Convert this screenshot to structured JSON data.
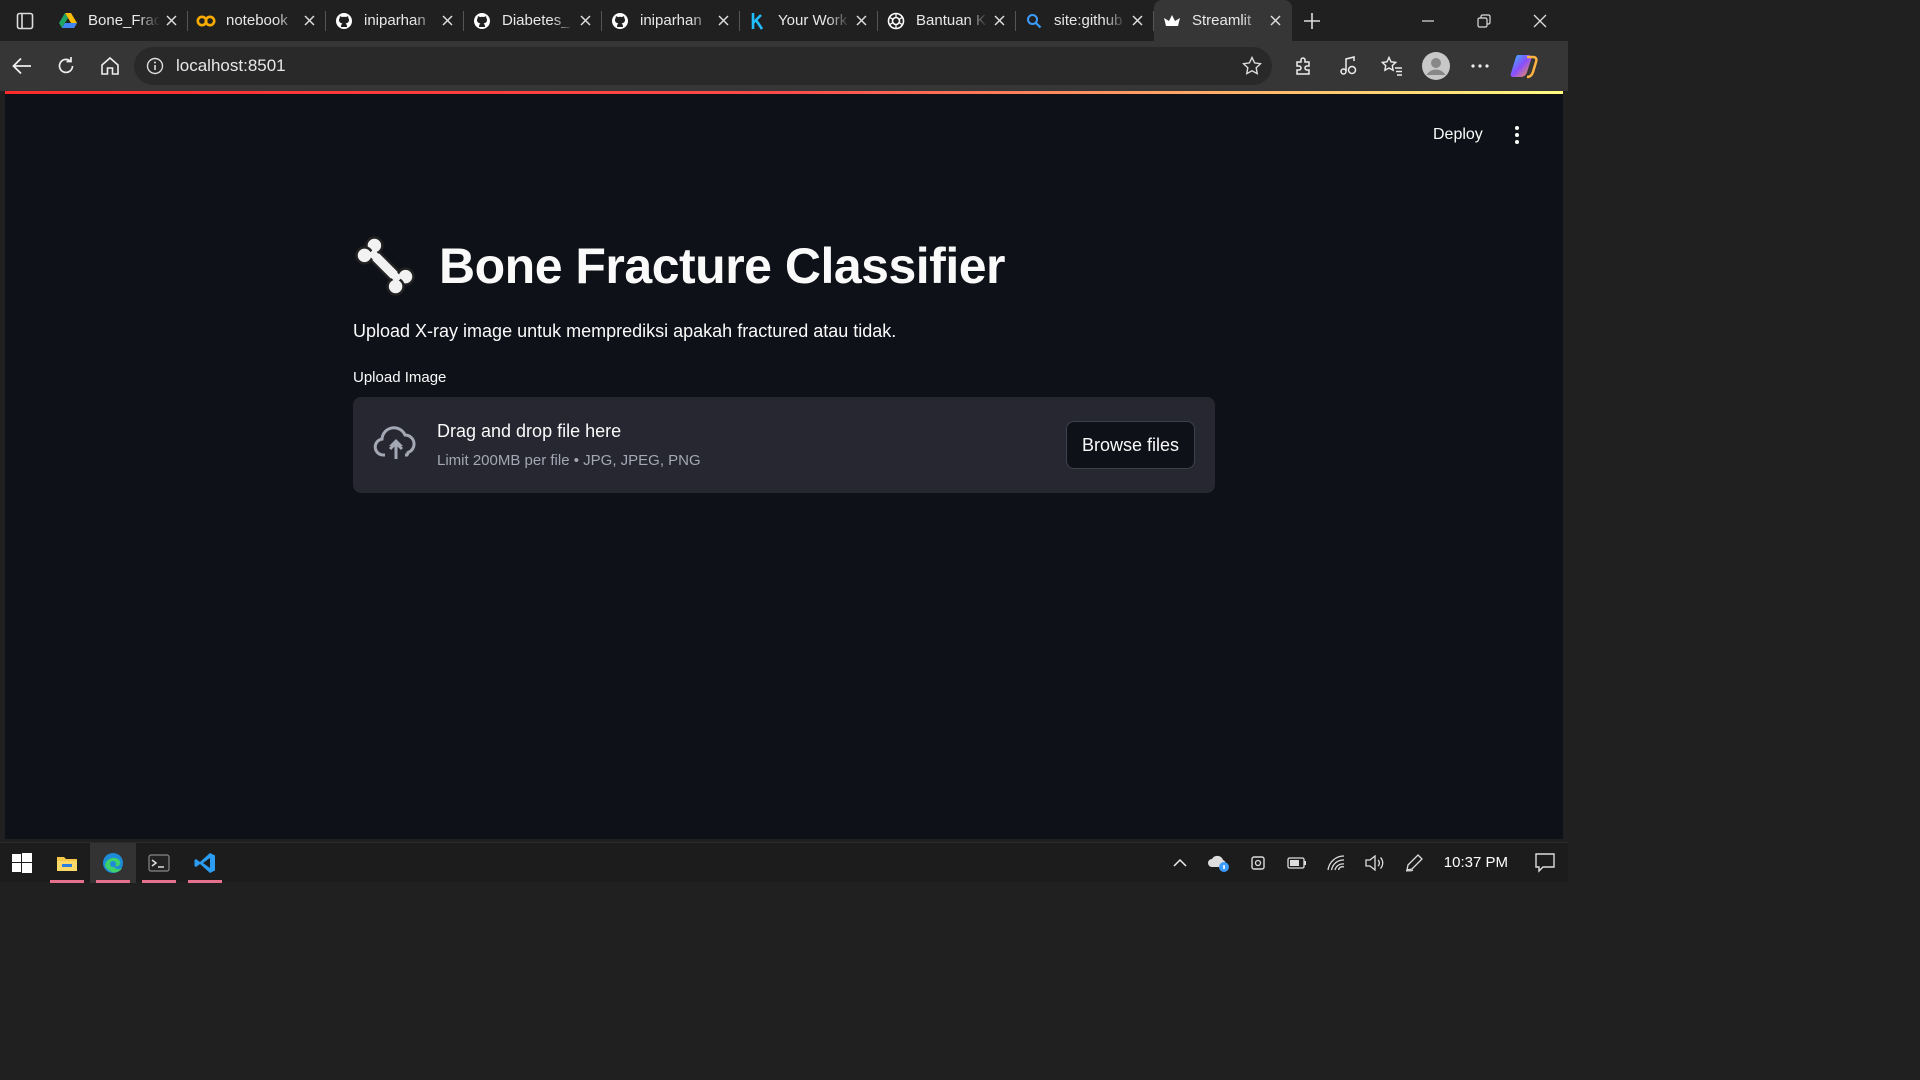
{
  "browser": {
    "tabs": [
      {
        "title": "Bone_Fracture",
        "favicon": "google-drive-icon",
        "active": false
      },
      {
        "title": "notebook",
        "favicon": "colab-icon",
        "active": false
      },
      {
        "title": "iniparhan",
        "favicon": "github-icon",
        "active": false
      },
      {
        "title": "Diabetes_",
        "favicon": "github-icon",
        "active": false
      },
      {
        "title": "iniparhan",
        "favicon": "github-icon",
        "active": false
      },
      {
        "title": "Your Work",
        "favicon": "kaggle-icon",
        "active": false
      },
      {
        "title": "Bantuan K",
        "favicon": "chatgpt-icon",
        "active": false
      },
      {
        "title": "site:github",
        "favicon": "search-icon",
        "active": false
      },
      {
        "title": "Streamlit",
        "favicon": "streamlit-icon",
        "active": true
      }
    ],
    "url": "localhost:8501"
  },
  "app": {
    "deploy_label": "Deploy",
    "title": "Bone Fracture Classifier",
    "title_emoji": "bone-icon",
    "description": "Upload X-ray image untuk memprediksi apakah fractured atau tidak.",
    "uploader": {
      "label": "Upload Image",
      "dropzone_title": "Drag and drop file here",
      "dropzone_subtitle": "Limit 200MB per file • JPG, JPEG, PNG",
      "browse_label": "Browse files"
    },
    "accent_color": "#ff4b4b",
    "background_color": "#0e1117"
  },
  "taskbar": {
    "apps": [
      "windows-start-icon",
      "file-explorer-icon",
      "edge-icon",
      "terminal-icon",
      "vscode-icon"
    ],
    "clock": "10:37 PM"
  }
}
